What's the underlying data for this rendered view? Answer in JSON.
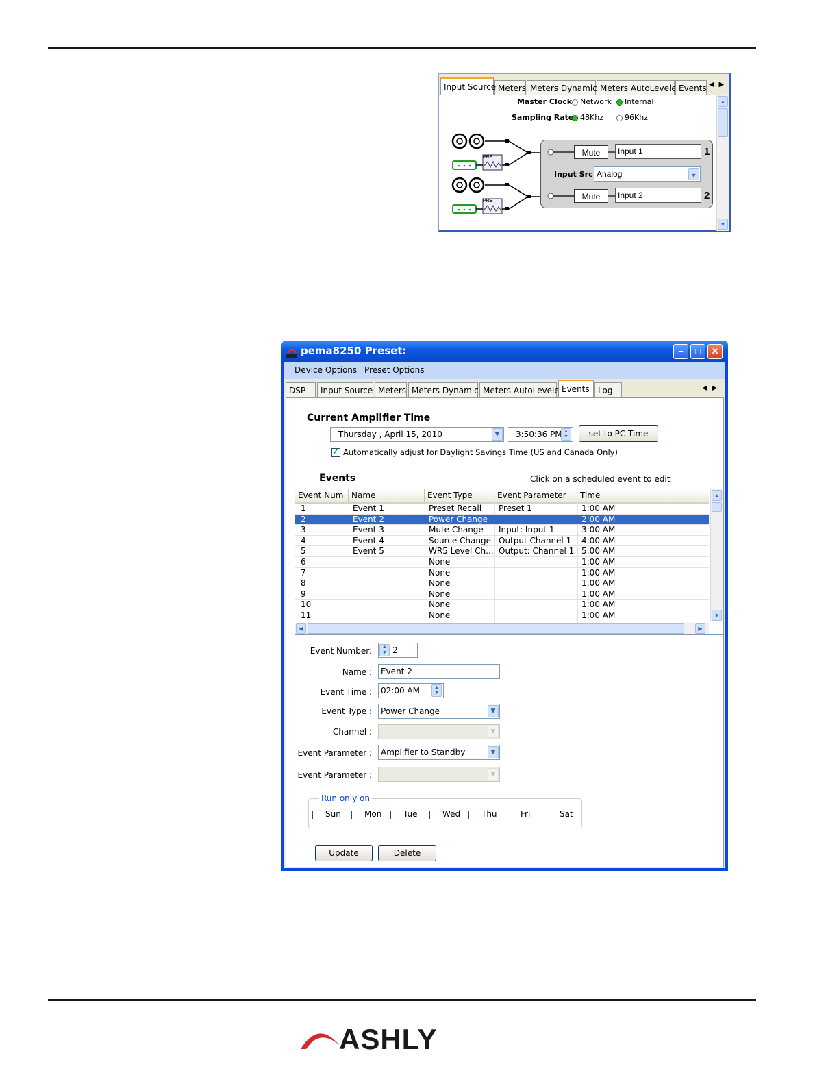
{
  "top_panel": {
    "tabs": [
      "Input Source",
      "Meters",
      "Meters Dynamics",
      "Meters AutoLeveler",
      "Events"
    ],
    "master_clock_label": "Master Clock",
    "master_clock_options": [
      "Network",
      "Internal"
    ],
    "master_clock_selected": "Internal",
    "sampling_rate_label": "Sampling Rate",
    "sampling_rate_options": [
      "48Khz",
      "96Khz"
    ],
    "sampling_rate_selected": "48Khz",
    "pre_label": "PRE",
    "input_src_label": "Input Src",
    "input_src_value": "Analog",
    "channels": [
      {
        "mute": "Mute",
        "name": "Input 1",
        "number": "1"
      },
      {
        "mute": "Mute",
        "name": "Input 2",
        "number": "2"
      }
    ]
  },
  "window": {
    "logo_text": "ASHLY",
    "title": "pema8250    Preset:",
    "menu": [
      "Device Options",
      "Preset Options"
    ],
    "tabs": [
      "DSP",
      "Input Source",
      "Meters",
      "Meters Dynamics",
      "Meters AutoLeveler",
      "Events",
      "Log"
    ],
    "active_tab": "Events",
    "amp_time_heading": "Current Amplifier Time",
    "date_value": "Thursday  ,     April     15, 2010",
    "time_value": "3:50:36 PM",
    "set_pc_time": "set to PC Time",
    "dst_label": "Automatically  adjust  for  Daylight Savings  Time (US  and  Canada  Only)",
    "dst_checked": true,
    "events_heading": "Events",
    "events_hint": "Click on a scheduled event to edit",
    "columns": [
      "Event Num",
      "Name",
      "Event Type",
      "Event Parameter",
      "Time"
    ],
    "rows": [
      [
        "1",
        "Event 1",
        "Preset Recall",
        "Preset 1",
        "1:00 AM"
      ],
      [
        "2",
        "Event 2",
        "Power Change",
        "",
        "2:00 AM"
      ],
      [
        "3",
        "Event 3",
        "Mute Change",
        "Input: Input 1",
        "3:00 AM"
      ],
      [
        "4",
        "Event 4",
        "Source Change",
        "Output Channel 1",
        "4:00 AM"
      ],
      [
        "5",
        "Event 5",
        "WR5 Level Ch...",
        "Output: Channel 1",
        "5:00 AM"
      ],
      [
        "6",
        "",
        "None",
        "",
        "1:00 AM"
      ],
      [
        "7",
        "",
        "None",
        "",
        "1:00 AM"
      ],
      [
        "8",
        "",
        "None",
        "",
        "1:00 AM"
      ],
      [
        "9",
        "",
        "None",
        "",
        "1:00 AM"
      ],
      [
        "10",
        "",
        "None",
        "",
        "1:00 AM"
      ],
      [
        "11",
        "",
        "None",
        "",
        "1:00 AM"
      ]
    ],
    "selected_row": "2",
    "form": {
      "event_number_label": "Event Number:",
      "event_number_value": "2",
      "name_label": "Name :",
      "name_value": "Event 2",
      "event_time_label": "Event Time :",
      "event_time_value": "02:00 AM",
      "event_type_label": "Event Type :",
      "event_type_value": "Power Change",
      "channel_label": "Channel :",
      "channel_value": "",
      "event_param1_label": "Event Parameter :",
      "event_param1_value": "Amplifier to Standby",
      "event_param2_label": "Event Parameter :",
      "event_param2_value": ""
    },
    "run_only_on_label": "Run only on",
    "days": [
      "Sun",
      "Mon",
      "Tue",
      "Wed",
      "Thu",
      "Fri",
      "Sat"
    ],
    "update_button": "Update",
    "delete_button": "Delete"
  },
  "footer": {
    "brand": "ASHLY"
  },
  "colors": {
    "xp_title_blue": "#0a4ad6",
    "selection_blue": "#316ac5",
    "led_green": "#22c022",
    "brand_red": "#d32a2a",
    "legend_blue": "#0046d5"
  }
}
